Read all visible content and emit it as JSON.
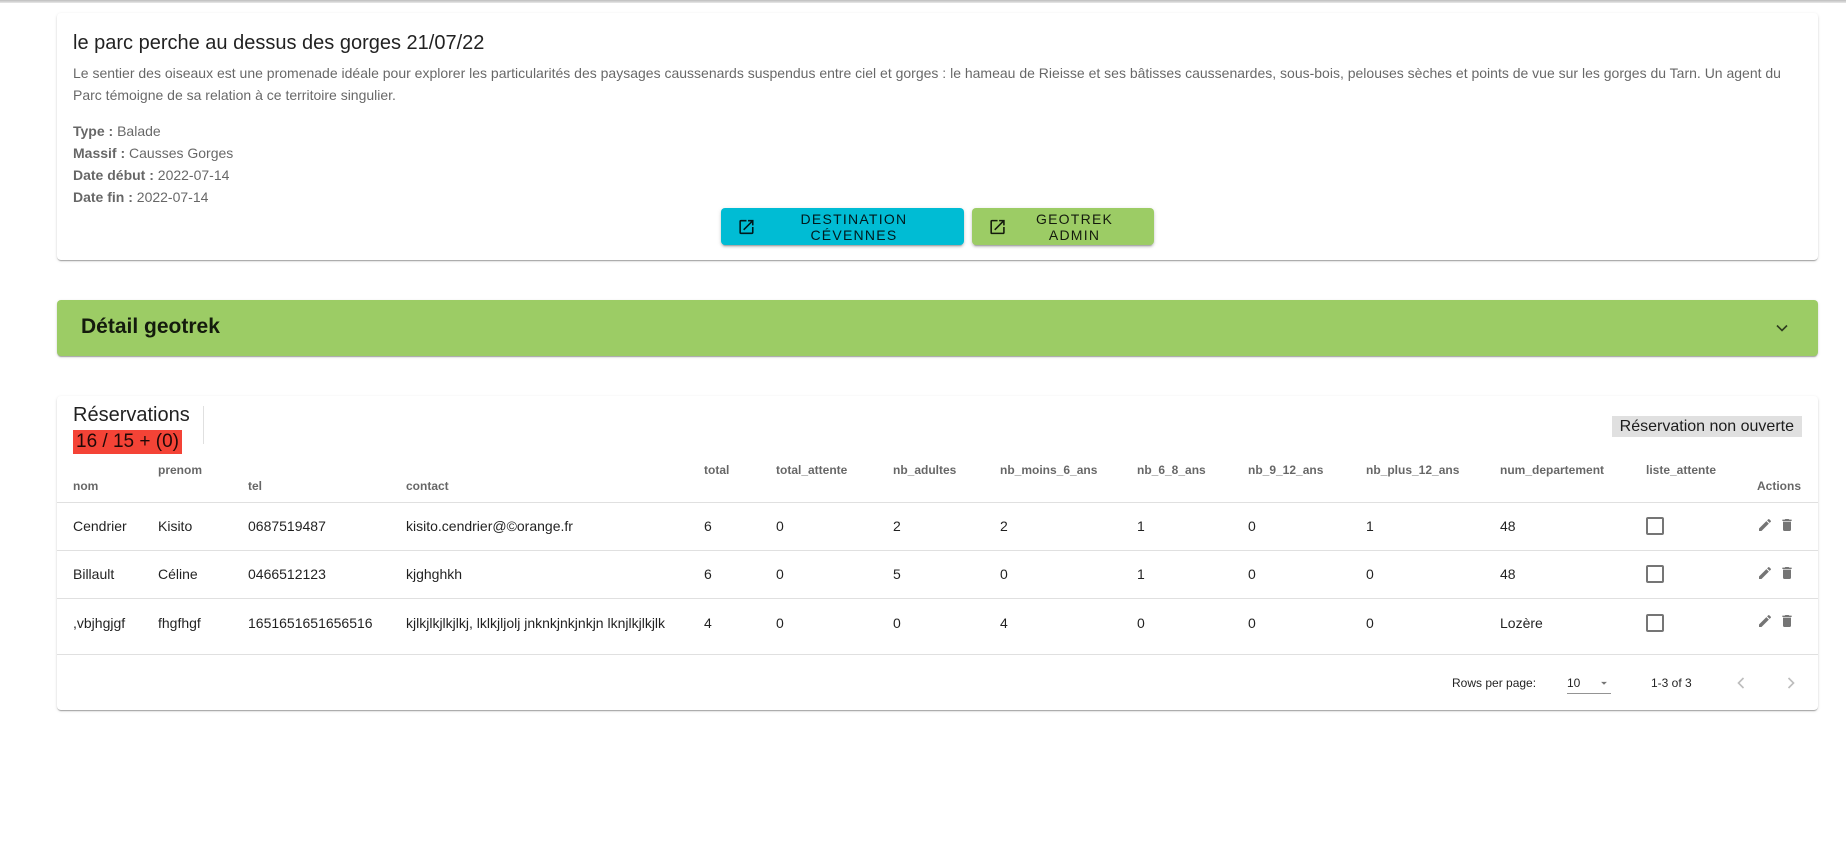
{
  "event": {
    "title": "le parc perche au dessus des gorges 21/07/22",
    "description": "Le sentier des oiseaux est une promenade idéale pour explorer les particularités des paysages caussenards suspendus entre ciel et gorges : le hameau de Rieisse et ses bâtisses caussenardes, sous-bois, pelouses sèches et points de vue sur les gorges du Tarn. Un agent du Parc témoigne de sa relation à ce territoire singulier.",
    "type_label": "Type :",
    "type_value": "Balade",
    "massif_label": "Massif :",
    "massif_value": "Causses Gorges",
    "date_debut_label": "Date début :",
    "date_debut_value": "2022-07-14",
    "date_fin_label": "Date fin :",
    "date_fin_value": "2022-07-14",
    "btn_destination": "Destination Cévennes",
    "btn_geotrek": "Geotrek admin",
    "btn_icon": "open-in-new-icon",
    "btn_destination_color": "#00bcd4",
    "btn_geotrek_color": "#9ccc65"
  },
  "panel": {
    "title": "Détail geotrek",
    "icon": "chevron-down-icon",
    "color": "#9ccc65"
  },
  "reservations": {
    "title": "Réservations",
    "count": "16 / 15 + (0)",
    "count_color": "#f44336",
    "status": "Réservation non ouverte",
    "headers": {
      "nom": "nom",
      "prenom": "prenom",
      "tel": "tel",
      "contact": "contact",
      "total": "total",
      "total_attente": "total_attente",
      "nb_adultes": "nb_adultes",
      "nb_moins_6_ans": "nb_moins_6_ans",
      "nb_6_8_ans": "nb_6_8_ans",
      "nb_9_12_ans": "nb_9_12_ans",
      "nb_plus_12_ans": "nb_plus_12_ans",
      "num_departement": "num_departement",
      "liste_attente": "liste_attente",
      "actions": "Actions"
    },
    "rows": [
      {
        "nom": "Cendrier",
        "prenom": "Kisito",
        "tel": "0687519487",
        "contact": "kisito.cendrier@©orange.fr",
        "total": "6",
        "total_attente": "0",
        "nb_adultes": "2",
        "nb_moins_6_ans": "2",
        "nb_6_8_ans": "1",
        "nb_9_12_ans": "0",
        "nb_plus_12_ans": "1",
        "num_departement": "48",
        "liste_attente": false
      },
      {
        "nom": "Billault",
        "prenom": "Céline",
        "tel": "0466512123",
        "contact": "kjghghkh",
        "total": "6",
        "total_attente": "0",
        "nb_adultes": "5",
        "nb_moins_6_ans": "0",
        "nb_6_8_ans": "1",
        "nb_9_12_ans": "0",
        "nb_plus_12_ans": "0",
        "num_departement": "48",
        "liste_attente": false
      },
      {
        "nom": ",vbjhgjgf",
        "prenom": "fhgfhgf",
        "tel": "1651651651656516",
        "contact": "kjlkjlkjlkjlkj, lklkjljolj jnknkjnkjnkjn lknjlkjlkjlk",
        "total": "4",
        "total_attente": "0",
        "nb_adultes": "0",
        "nb_moins_6_ans": "4",
        "nb_6_8_ans": "0",
        "nb_9_12_ans": "0",
        "nb_plus_12_ans": "0",
        "num_departement": "Lozère",
        "liste_attente": false
      }
    ],
    "footer": {
      "rows_per_page_label": "Rows per page:",
      "rows_per_page_value": "10",
      "range": "1-3 of 3"
    }
  }
}
